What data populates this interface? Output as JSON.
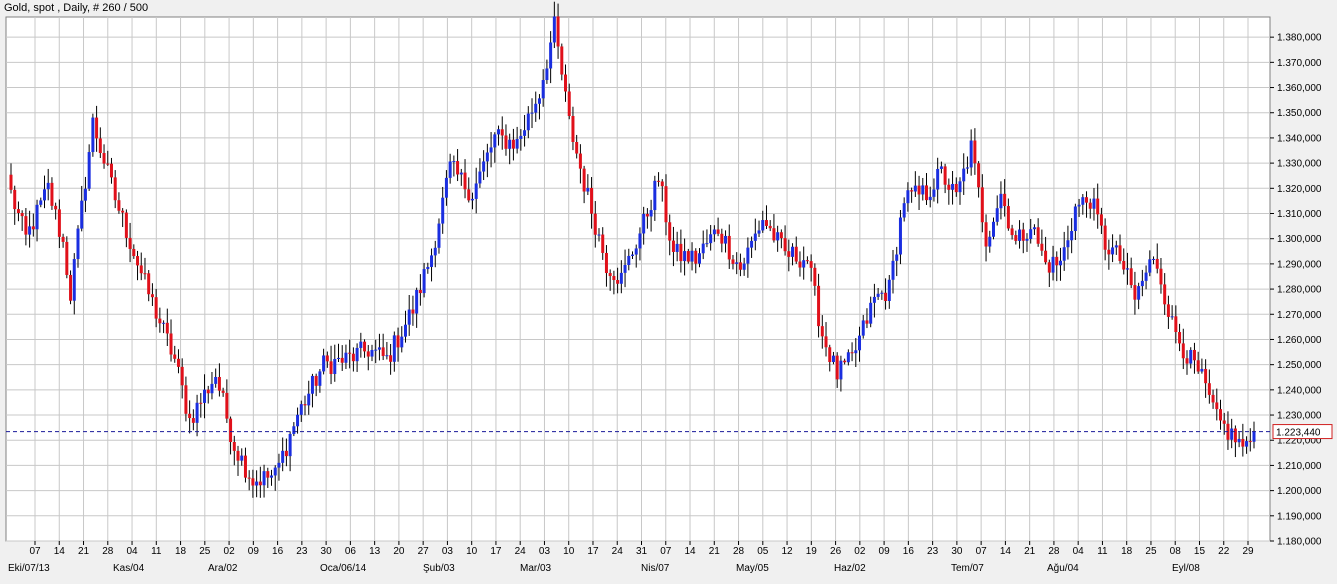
{
  "header": {
    "title": "Gold, spot , Daily, # 260 / 500"
  },
  "current_price_label": "1.223,440",
  "colors": {
    "up": "#1a2ee0",
    "down": "#e0101a",
    "wick": "#000000",
    "grid": "#c8c8c8",
    "current_line": "#1a1a9a",
    "current_label_border": "#d02020"
  },
  "chart_data": {
    "type": "candlestick",
    "title": "Gold, spot , Daily, # 260 / 500",
    "grid": true,
    "ylim": [
      1180000,
      1388000
    ],
    "y_ticks": [
      1180000,
      1190000,
      1200000,
      1210000,
      1220000,
      1230000,
      1240000,
      1250000,
      1260000,
      1270000,
      1280000,
      1290000,
      1300000,
      1310000,
      1320000,
      1330000,
      1340000,
      1350000,
      1360000,
      1370000,
      1380000
    ],
    "y_tick_labels": [
      "1.180,000",
      "1.190,000",
      "1.200,000",
      "1.210,000",
      "1.220,000",
      "1.230,000",
      "1.240,000",
      "1.250,000",
      "1.260,000",
      "1.270,000",
      "1.280,000",
      "1.290,000",
      "1.300,000",
      "1.310,000",
      "1.320,000",
      "1.330,000",
      "1.340,000",
      "1.350,000",
      "1.360,000",
      "1.370,000",
      "1.380,000"
    ],
    "current_price": 1223440,
    "x_day_labels": [
      "07",
      "14",
      "21",
      "28",
      "04",
      "11",
      "18",
      "25",
      "02",
      "09",
      "16",
      "23",
      "30",
      "06",
      "13",
      "20",
      "27",
      "03",
      "10",
      "17",
      "24",
      "03",
      "10",
      "17",
      "24",
      "31",
      "07",
      "14",
      "21",
      "28",
      "05",
      "12",
      "19",
      "26",
      "02",
      "09",
      "16",
      "23",
      "30",
      "07",
      "14",
      "21",
      "28",
      "04",
      "11",
      "18",
      "25",
      "08",
      "15",
      "22",
      "29"
    ],
    "x_month_labels": [
      "Eki/07/13",
      "Kas/04",
      "Ara/02",
      "Oca/06/14",
      "Şub/03",
      "Mar/03",
      "Nis/07",
      "May/05",
      "Haz/02",
      "Tem/07",
      "Ağu/04",
      "Eyl/08"
    ],
    "key_levels": [
      {
        "t": 0,
        "v": 1318000
      },
      {
        "t": 4,
        "v": 1300000
      },
      {
        "t": 10,
        "v": 1320000
      },
      {
        "t": 14,
        "v": 1298000
      },
      {
        "t": 16,
        "v": 1278000
      },
      {
        "t": 22,
        "v": 1346000
      },
      {
        "t": 28,
        "v": 1316000
      },
      {
        "t": 36,
        "v": 1282000
      },
      {
        "t": 44,
        "v": 1252000
      },
      {
        "t": 48,
        "v": 1228000
      },
      {
        "t": 55,
        "v": 1246000
      },
      {
        "t": 60,
        "v": 1218000
      },
      {
        "t": 65,
        "v": 1204000
      },
      {
        "t": 71,
        "v": 1206000
      },
      {
        "t": 77,
        "v": 1230000
      },
      {
        "t": 84,
        "v": 1250000
      },
      {
        "t": 90,
        "v": 1252000
      },
      {
        "t": 96,
        "v": 1256000
      },
      {
        "t": 101,
        "v": 1252000
      },
      {
        "t": 108,
        "v": 1272000
      },
      {
        "t": 113,
        "v": 1294000
      },
      {
        "t": 118,
        "v": 1328000
      },
      {
        "t": 124,
        "v": 1318000
      },
      {
        "t": 130,
        "v": 1340000
      },
      {
        "t": 136,
        "v": 1338000
      },
      {
        "t": 142,
        "v": 1358000
      },
      {
        "t": 146,
        "v": 1384000
      },
      {
        "t": 150,
        "v": 1346000
      },
      {
        "t": 154,
        "v": 1322000
      },
      {
        "t": 160,
        "v": 1290000
      },
      {
        "t": 164,
        "v": 1284000
      },
      {
        "t": 170,
        "v": 1306000
      },
      {
        "t": 174,
        "v": 1324000
      },
      {
        "t": 178,
        "v": 1294000
      },
      {
        "t": 184,
        "v": 1292000
      },
      {
        "t": 190,
        "v": 1304000
      },
      {
        "t": 196,
        "v": 1288000
      },
      {
        "t": 202,
        "v": 1308000
      },
      {
        "t": 208,
        "v": 1294000
      },
      {
        "t": 214,
        "v": 1292000
      },
      {
        "t": 218,
        "v": 1262000
      },
      {
        "t": 222,
        "v": 1246000
      },
      {
        "t": 226,
        "v": 1252000
      },
      {
        "t": 232,
        "v": 1276000
      },
      {
        "t": 236,
        "v": 1280000
      },
      {
        "t": 240,
        "v": 1316000
      },
      {
        "t": 246,
        "v": 1318000
      },
      {
        "t": 250,
        "v": 1326000
      },
      {
        "t": 254,
        "v": 1316000
      },
      {
        "t": 258,
        "v": 1336000
      },
      {
        "t": 262,
        "v": 1300000
      },
      {
        "t": 266,
        "v": 1318000
      },
      {
        "t": 270,
        "v": 1298000
      },
      {
        "t": 274,
        "v": 1306000
      },
      {
        "t": 278,
        "v": 1290000
      },
      {
        "t": 282,
        "v": 1290000
      },
      {
        "t": 286,
        "v": 1312000
      },
      {
        "t": 290,
        "v": 1316000
      },
      {
        "t": 294,
        "v": 1298000
      },
      {
        "t": 298,
        "v": 1292000
      },
      {
        "t": 302,
        "v": 1276000
      },
      {
        "t": 306,
        "v": 1290000
      },
      {
        "t": 308,
        "v": 1290000
      },
      {
        "t": 312,
        "v": 1266000
      },
      {
        "t": 316,
        "v": 1254000
      },
      {
        "t": 320,
        "v": 1244000
      },
      {
        "t": 324,
        "v": 1228000
      },
      {
        "t": 328,
        "v": 1222000
      },
      {
        "t": 332,
        "v": 1216000
      },
      {
        "t": 334,
        "v": 1223440
      }
    ]
  }
}
